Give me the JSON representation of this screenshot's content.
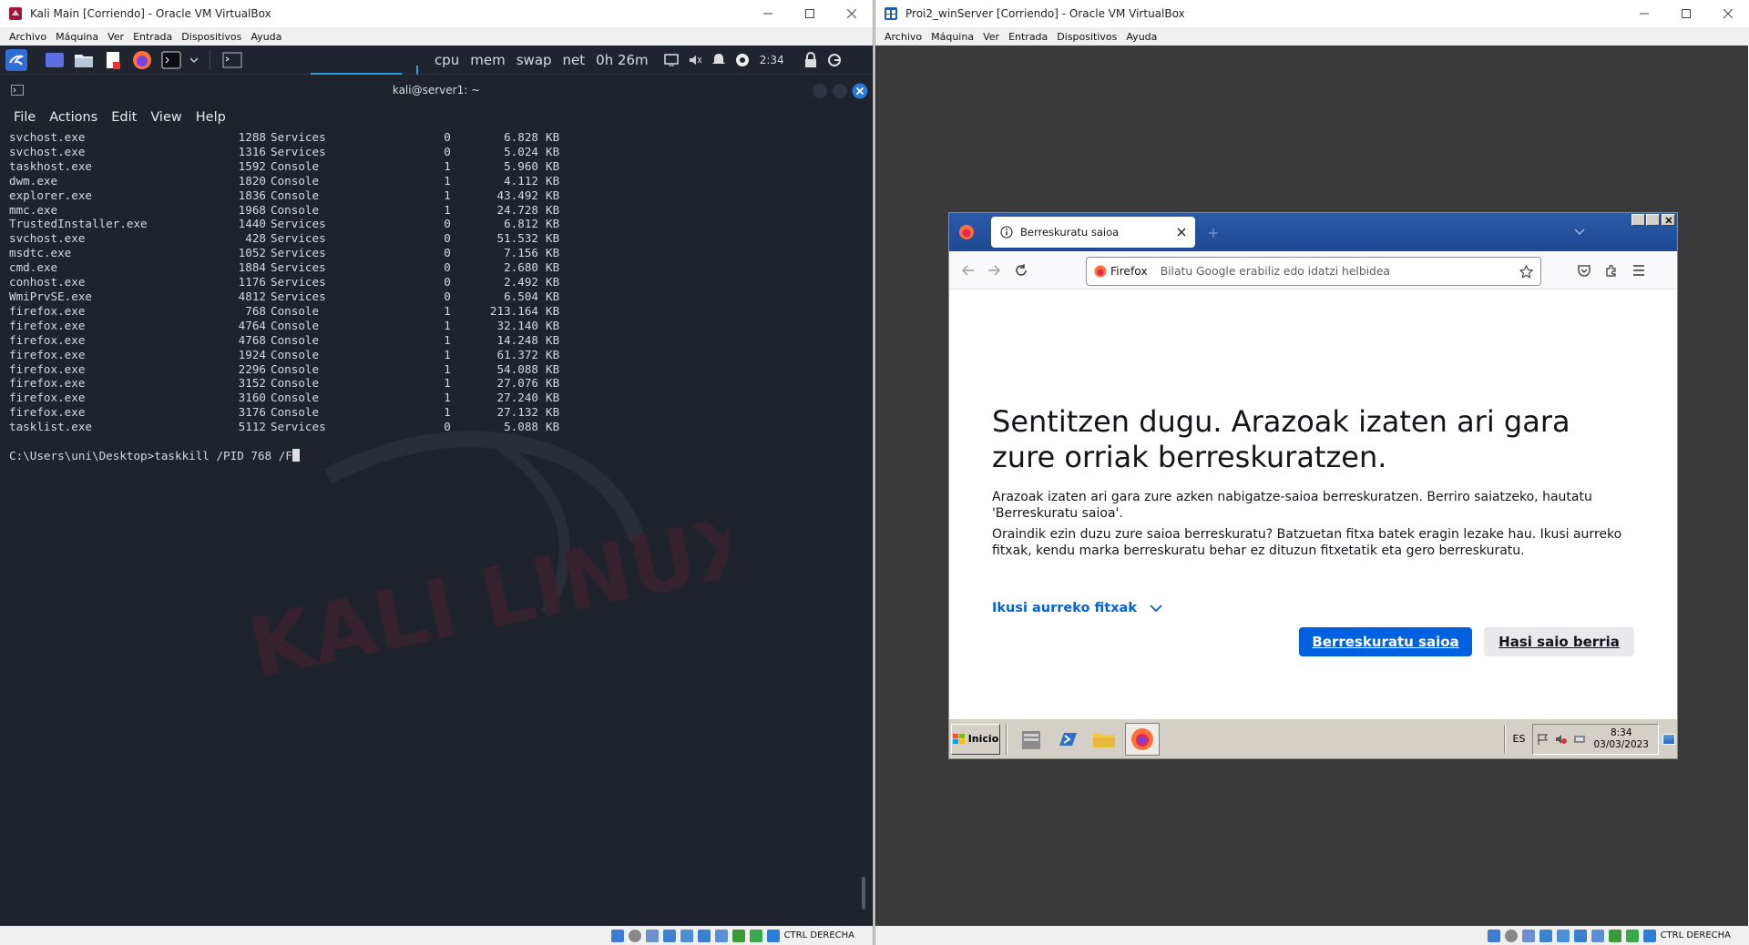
{
  "left_window": {
    "title": "Kali Main [Corriendo] - Oracle VM VirtualBox",
    "menu": [
      "Archivo",
      "Máquina",
      "Ver",
      "Entrada",
      "Dispositivos",
      "Ayuda"
    ],
    "host_key": "CTRL DERECHA"
  },
  "right_window": {
    "title": "Proi2_winServer [Corriendo] - Oracle VM VirtualBox",
    "menu": [
      "Archivo",
      "Máquina",
      "Ver",
      "Entrada",
      "Dispositivos",
      "Ayuda"
    ],
    "host_key": "CTRL DERECHA"
  },
  "kali_panel": {
    "monitors": [
      "cpu",
      "mem",
      "swap",
      "net"
    ],
    "uptime": "0h 26m",
    "clock": "2:34"
  },
  "terminal": {
    "title": "kali@server1: ~",
    "menu": [
      "File",
      "Actions",
      "Edit",
      "View",
      "Help"
    ],
    "rows": [
      {
        "name": "svchost.exe",
        "pid": "1288",
        "session": "Services",
        "num": "0",
        "mem": "6.828",
        "unit": "KB"
      },
      {
        "name": "svchost.exe",
        "pid": "1316",
        "session": "Services",
        "num": "0",
        "mem": "5.024",
        "unit": "KB"
      },
      {
        "name": "taskhost.exe",
        "pid": "1592",
        "session": "Console",
        "num": "1",
        "mem": "5.960",
        "unit": "KB"
      },
      {
        "name": "dwm.exe",
        "pid": "1820",
        "session": "Console",
        "num": "1",
        "mem": "4.112",
        "unit": "KB"
      },
      {
        "name": "explorer.exe",
        "pid": "1836",
        "session": "Console",
        "num": "1",
        "mem": "43.492",
        "unit": "KB"
      },
      {
        "name": "mmc.exe",
        "pid": "1968",
        "session": "Console",
        "num": "1",
        "mem": "24.728",
        "unit": "KB"
      },
      {
        "name": "TrustedInstaller.exe",
        "pid": "1440",
        "session": "Services",
        "num": "0",
        "mem": "6.812",
        "unit": "KB"
      },
      {
        "name": "svchost.exe",
        "pid": "428",
        "session": "Services",
        "num": "0",
        "mem": "51.532",
        "unit": "KB"
      },
      {
        "name": "msdtc.exe",
        "pid": "1052",
        "session": "Services",
        "num": "0",
        "mem": "7.156",
        "unit": "KB"
      },
      {
        "name": "cmd.exe",
        "pid": "1884",
        "session": "Services",
        "num": "0",
        "mem": "2.680",
        "unit": "KB"
      },
      {
        "name": "conhost.exe",
        "pid": "1176",
        "session": "Services",
        "num": "0",
        "mem": "2.492",
        "unit": "KB"
      },
      {
        "name": "WmiPrvSE.exe",
        "pid": "4812",
        "session": "Services",
        "num": "0",
        "mem": "6.504",
        "unit": "KB"
      },
      {
        "name": "firefox.exe",
        "pid": "768",
        "session": "Console",
        "num": "1",
        "mem": "213.164",
        "unit": "KB"
      },
      {
        "name": "firefox.exe",
        "pid": "4764",
        "session": "Console",
        "num": "1",
        "mem": "32.140",
        "unit": "KB"
      },
      {
        "name": "firefox.exe",
        "pid": "4768",
        "session": "Console",
        "num": "1",
        "mem": "14.248",
        "unit": "KB"
      },
      {
        "name": "firefox.exe",
        "pid": "1924",
        "session": "Console",
        "num": "1",
        "mem": "61.372",
        "unit": "KB"
      },
      {
        "name": "firefox.exe",
        "pid": "2296",
        "session": "Console",
        "num": "1",
        "mem": "54.088",
        "unit": "KB"
      },
      {
        "name": "firefox.exe",
        "pid": "3152",
        "session": "Console",
        "num": "1",
        "mem": "27.076",
        "unit": "KB"
      },
      {
        "name": "firefox.exe",
        "pid": "3160",
        "session": "Console",
        "num": "1",
        "mem": "27.240",
        "unit": "KB"
      },
      {
        "name": "firefox.exe",
        "pid": "3176",
        "session": "Console",
        "num": "1",
        "mem": "27.132",
        "unit": "KB"
      },
      {
        "name": "tasklist.exe",
        "pid": "5112",
        "session": "Services",
        "num": "0",
        "mem": "5.088",
        "unit": "KB"
      }
    ],
    "prompt": "C:\\Users\\uni\\Desktop>",
    "command": "taskkill /PID 768 /F"
  },
  "firefox": {
    "tab_title": "Berreskuratu saioa",
    "url_brand": "Firefox",
    "url_placeholder": "Bilatu Google erabiliz edo idatzi helbidea",
    "heading": "Sentitzen dugu. Arazoak izaten ari gara zure orriak berreskuratzen.",
    "para1": "Arazoak izaten ari gara zure azken nabigatze-saioa berreskuratzen. Berriro saiatzeko, hautatu 'Berreskuratu saioa'.",
    "para2": "Oraindik ezin duzu zure saioa berreskuratu? Batzuetan fitxa batek eragin lezake hau. Ikusi aurreko fitxak, kendu marka berreskuratu behar ez dituzun fitxetatik eta gero berreskuratu.",
    "show_tabs_link": "Ikusi aurreko fitxak",
    "restore_button": "Berreskuratu saioa",
    "new_session_button": "Hasi saio berria"
  },
  "win_taskbar": {
    "start_label": "Inicio",
    "language": "ES",
    "time": "8:34",
    "date": "03/03/2023"
  },
  "colors": {
    "kali_bg": "#1d212a",
    "firefox_primary": "#0061e0",
    "win7_taskbar": "#d4d0c8"
  }
}
